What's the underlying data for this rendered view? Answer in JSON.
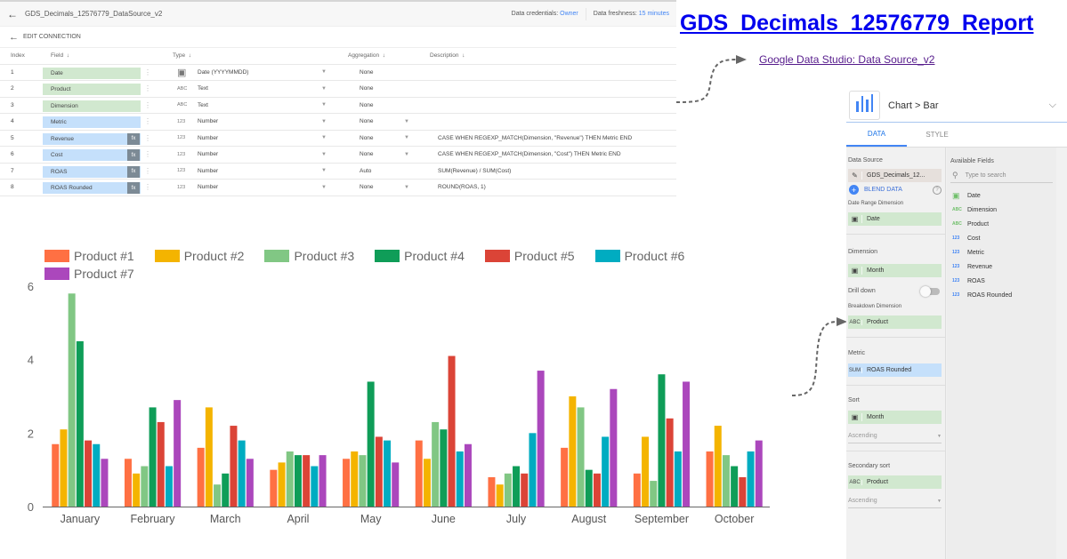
{
  "data_source_editor": {
    "title": "GDS_Decimals_12576779_DataSource_v2",
    "credentials_label": "Data credentials:",
    "credentials_value": "Owner",
    "freshness_label": "Data freshness:",
    "freshness_value": "15 minutes",
    "edit_connection": "EDIT CONNECTION",
    "columns": {
      "index": "Index",
      "field": "Field",
      "type": "Type",
      "aggregation": "Aggregation",
      "description": "Description"
    },
    "rows": [
      {
        "index": "1",
        "field": "Date",
        "kind": "dim",
        "calc": false,
        "type_icon": "calendar",
        "type": "Date (YYYYMMDD)",
        "aggregation": "None",
        "agg_dropdown": false,
        "description": ""
      },
      {
        "index": "2",
        "field": "Product",
        "kind": "dim",
        "calc": false,
        "type_icon": "ABC",
        "type": "Text",
        "aggregation": "None",
        "agg_dropdown": false,
        "description": ""
      },
      {
        "index": "3",
        "field": "Dimension",
        "kind": "dim",
        "calc": false,
        "type_icon": "ABC",
        "type": "Text",
        "aggregation": "None",
        "agg_dropdown": false,
        "description": ""
      },
      {
        "index": "4",
        "field": "Metric",
        "kind": "met",
        "calc": false,
        "type_icon": "123",
        "type": "Number",
        "aggregation": "None",
        "agg_dropdown": true,
        "description": ""
      },
      {
        "index": "5",
        "field": "Revenue",
        "kind": "met",
        "calc": true,
        "type_icon": "123",
        "type": "Number",
        "aggregation": "None",
        "agg_dropdown": true,
        "description": "CASE WHEN REGEXP_MATCH(Dimension, \"Revenue\") THEN Metric END"
      },
      {
        "index": "6",
        "field": "Cost",
        "kind": "met",
        "calc": true,
        "type_icon": "123",
        "type": "Number",
        "aggregation": "None",
        "agg_dropdown": true,
        "description": "CASE WHEN REGEXP_MATCH(Dimension, \"Cost\") THEN Metric END"
      },
      {
        "index": "7",
        "field": "ROAS",
        "kind": "met",
        "calc": true,
        "type_icon": "123",
        "type": "Number",
        "aggregation": "Auto",
        "agg_dropdown": false,
        "description": "SUM(Revenue) / SUM(Cost)"
      },
      {
        "index": "8",
        "field": "ROAS Rounded",
        "kind": "met",
        "calc": true,
        "type_icon": "123",
        "type": "Number",
        "aggregation": "None",
        "agg_dropdown": true,
        "description": "ROUND(ROAS, 1)"
      }
    ],
    "fx_label": "fx"
  },
  "report_title": "GDS_Decimals_12576779_Report",
  "data_source_link": "Google Data Studio: Data Source_v2",
  "panel": {
    "header": "Chart > Bar",
    "tabs": [
      "DATA",
      "STYLE"
    ],
    "active_tab": "DATA",
    "data_source_label": "Data Source",
    "data_source_value": "GDS_Decimals_12...",
    "blend_data": "BLEND DATA",
    "date_range_label": "Date Range Dimension",
    "date_range_value": "Date",
    "dimension_label": "Dimension",
    "dimension_value": "Month",
    "drill_down_label": "Drill down",
    "drill_down_on": false,
    "breakdown_label": "Breakdown Dimension",
    "breakdown_value": "Product",
    "breakdown_type": "ABC",
    "metric_label": "Metric",
    "metric_agg": "SUM",
    "metric_value": "ROAS Rounded",
    "sort_label": "Sort",
    "sort_value": "Month",
    "sort_order": "Ascending",
    "secondary_sort_label": "Secondary sort",
    "secondary_sort_value": "Product",
    "secondary_sort_type": "ABC",
    "secondary_sort_order": "Ascending",
    "available_fields_label": "Available Fields",
    "search_placeholder": "Type to search",
    "available_fields": [
      {
        "type": "cal",
        "name": "Date"
      },
      {
        "type": "ABC",
        "name": "Dimension"
      },
      {
        "type": "ABC",
        "name": "Product"
      },
      {
        "type": "123",
        "name": "Cost"
      },
      {
        "type": "123",
        "name": "Metric"
      },
      {
        "type": "123",
        "name": "Revenue"
      },
      {
        "type": "123",
        "name": "ROAS"
      },
      {
        "type": "123",
        "name": "ROAS Rounded"
      }
    ]
  },
  "chart_data": {
    "type": "bar",
    "title": "",
    "xlabel": "",
    "ylabel": "",
    "ylim": [
      0,
      6
    ],
    "yticks": [
      0,
      2,
      4,
      6
    ],
    "legend_position": "top",
    "grid": false,
    "categories": [
      "January",
      "February",
      "March",
      "April",
      "May",
      "June",
      "July",
      "August",
      "September",
      "October"
    ],
    "series": [
      {
        "name": "Product #1",
        "color": "#ff7043",
        "values": [
          1.7,
          1.3,
          1.6,
          1.0,
          1.3,
          1.8,
          0.8,
          1.6,
          0.9,
          1.5
        ]
      },
      {
        "name": "Product #2",
        "color": "#f4b400",
        "values": [
          2.1,
          0.9,
          2.7,
          1.2,
          1.5,
          1.3,
          0.6,
          3.0,
          1.9,
          2.2
        ]
      },
      {
        "name": "Product #3",
        "color": "#81c784",
        "values": [
          5.8,
          1.1,
          0.6,
          1.5,
          1.4,
          2.3,
          0.9,
          2.7,
          0.7,
          1.4
        ]
      },
      {
        "name": "Product #4",
        "color": "#0f9d58",
        "values": [
          4.5,
          2.7,
          0.9,
          1.4,
          3.4,
          2.1,
          1.1,
          1.0,
          3.6,
          1.1
        ]
      },
      {
        "name": "Product #5",
        "color": "#db4437",
        "values": [
          1.8,
          2.3,
          2.2,
          1.4,
          1.9,
          4.1,
          0.9,
          0.9,
          2.4,
          0.8
        ]
      },
      {
        "name": "Product #6",
        "color": "#00acc1",
        "values": [
          1.7,
          1.1,
          1.8,
          1.1,
          1.8,
          1.5,
          2.0,
          1.9,
          1.5,
          1.5
        ]
      },
      {
        "name": "Product #7",
        "color": "#ab47bc",
        "values": [
          1.3,
          2.9,
          1.3,
          1.4,
          1.2,
          1.7,
          3.7,
          3.2,
          3.4,
          1.8
        ]
      }
    ]
  }
}
